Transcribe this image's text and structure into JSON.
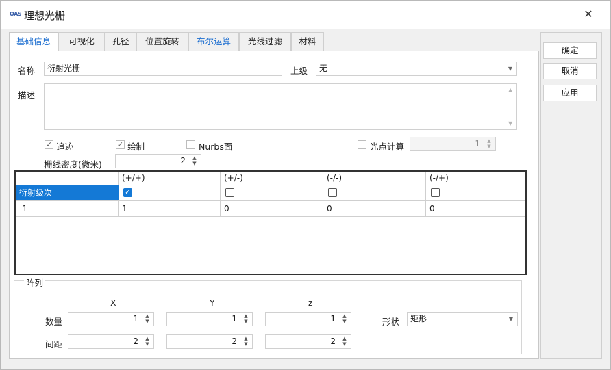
{
  "window": {
    "title": "理想光栅",
    "logo_text": "OAS",
    "close_glyph": "✕"
  },
  "tabs": [
    {
      "label": "基础信息",
      "active": true
    },
    {
      "label": "可视化"
    },
    {
      "label": "孔径"
    },
    {
      "label": "位置旋转"
    },
    {
      "label": "布尔运算",
      "highlight": true
    },
    {
      "label": "光线过滤"
    },
    {
      "label": "材料"
    }
  ],
  "basic": {
    "name_label": "名称",
    "name_value": "衍射光栅",
    "parent_label": "上级",
    "parent_value": "无",
    "desc_label": "描述",
    "desc_value": ""
  },
  "options": {
    "trace_label": "追迹",
    "trace_checked": true,
    "draw_label": "绘制",
    "draw_checked": true,
    "nurbs_label": "Nurbs面",
    "nurbs_checked": false,
    "spot_label": "光点计算",
    "spot_checked": false,
    "spot_value": "-1",
    "density_label": "栅线密度(微米)",
    "density_value": "2"
  },
  "order_table": {
    "headers": [
      "",
      "(+/+)",
      "(+/-)",
      "(-/-)",
      "(-/+)"
    ],
    "row_label": "衍射级次",
    "checks": [
      true,
      false,
      false,
      false
    ],
    "row2": [
      "-1",
      "1",
      "0",
      "0",
      "0"
    ]
  },
  "array": {
    "title": "阵列",
    "col_x": "X",
    "col_y": "Y",
    "col_z": "z",
    "count_label": "数量",
    "count": [
      "1",
      "1",
      "1"
    ],
    "spacing_label": "间距",
    "spacing": [
      "2",
      "2",
      "2"
    ],
    "shape_label": "形状",
    "shape_value": "矩形"
  },
  "actions": {
    "ok": "确定",
    "cancel": "取消",
    "apply": "应用"
  },
  "colors": {
    "accent": "#1e6fd0",
    "selection": "#1479d6"
  }
}
